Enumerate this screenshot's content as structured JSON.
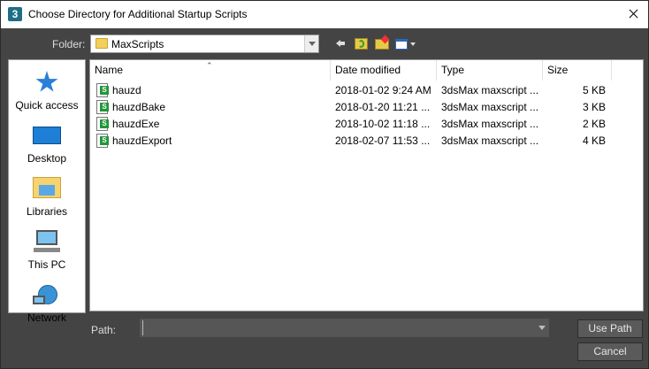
{
  "window": {
    "title": "Choose Directory for Additional Startup Scripts",
    "app_icon_text": "3"
  },
  "folder": {
    "label": "Folder:",
    "value": "MaxScripts"
  },
  "places": [
    {
      "label": "Quick access",
      "icon": "star-icon"
    },
    {
      "label": "Desktop",
      "icon": "desktop-icon"
    },
    {
      "label": "Libraries",
      "icon": "libraries-icon"
    },
    {
      "label": "This PC",
      "icon": "computer-icon"
    },
    {
      "label": "Network",
      "icon": "network-icon"
    }
  ],
  "columns": [
    "Name",
    "Date modified",
    "Type",
    "Size"
  ],
  "files": [
    {
      "name": "hauzd",
      "date": "2018-01-02 9:24 AM",
      "type": "3dsMax maxscript ...",
      "size": "5 KB"
    },
    {
      "name": "hauzdBake",
      "date": "2018-01-20 11:21 ...",
      "type": "3dsMax maxscript ...",
      "size": "3 KB"
    },
    {
      "name": "hauzdExe",
      "date": "2018-10-02 11:18 ...",
      "type": "3dsMax maxscript ...",
      "size": "2 KB"
    },
    {
      "name": "hauzdExport",
      "date": "2018-02-07 11:53 ...",
      "type": "3dsMax maxscript ...",
      "size": "4 KB"
    }
  ],
  "path": {
    "label": "Path:",
    "value": ""
  },
  "buttons": {
    "use_path": "Use Path",
    "cancel": "Cancel"
  }
}
